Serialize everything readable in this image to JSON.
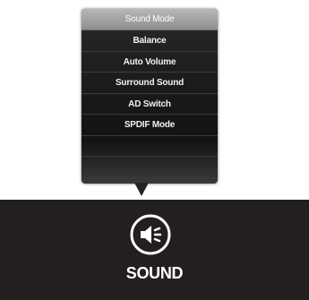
{
  "menu": {
    "items": [
      {
        "label": "Sound Mode",
        "selected": true
      },
      {
        "label": "Balance",
        "selected": false
      },
      {
        "label": "Auto Volume",
        "selected": false
      },
      {
        "label": "Surround Sound",
        "selected": false
      },
      {
        "label": "AD Switch",
        "selected": false
      },
      {
        "label": "SPDIF Mode",
        "selected": false
      },
      {
        "label": "",
        "selected": false
      },
      {
        "label": "",
        "selected": false
      }
    ]
  },
  "bar": {
    "icon": "speaker-icon",
    "label": "SOUND"
  },
  "colors": {
    "menu_bg": "#1c1c1c",
    "selected_bg": "#a3a3a3",
    "bar_bg": "#231f20",
    "text": "#ffffff"
  }
}
